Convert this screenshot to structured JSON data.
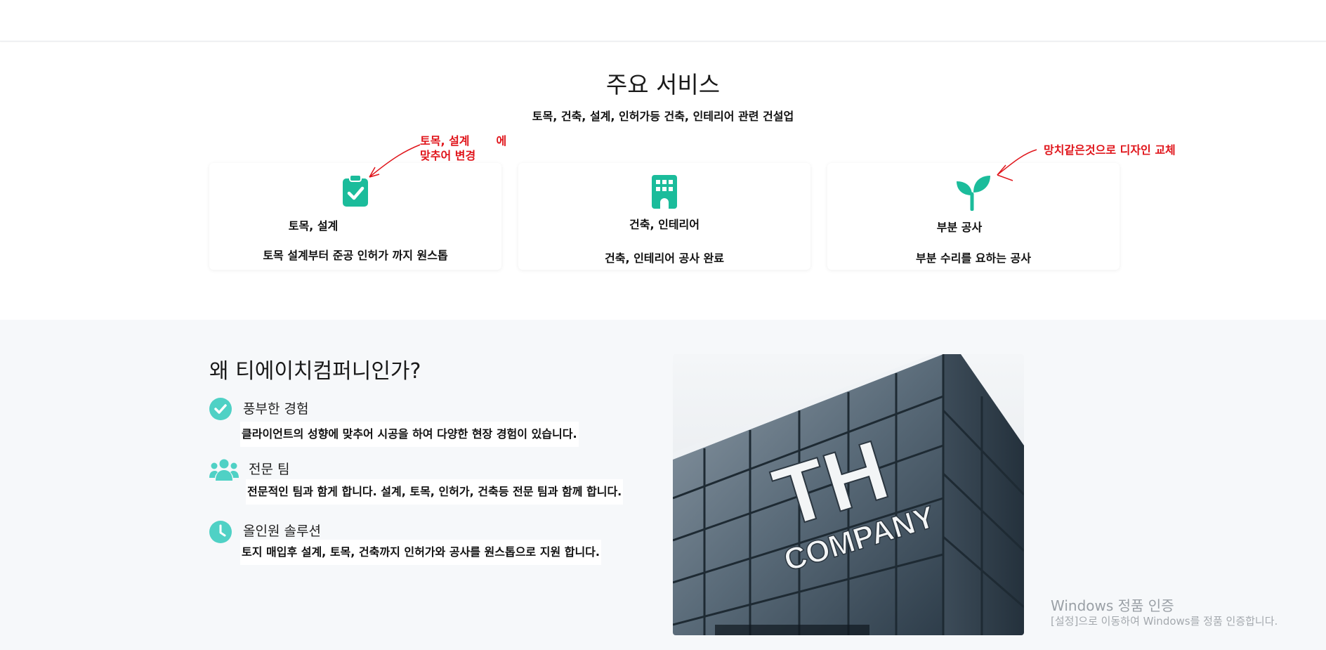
{
  "services": {
    "title": "주요 서비스",
    "subtitle": "토목, 건축, 설계, 인허가등 건축, 인테리어 관련 건설업",
    "cards": [
      {
        "icon": "clipboard-check-icon",
        "title": "토목, 설계",
        "desc": "토목 설계부터 준공 인허가 까지 원스톱"
      },
      {
        "icon": "building-icon",
        "title": "건축, 인테리어",
        "desc": "건축, 인테리어 공사 완료"
      },
      {
        "icon": "sprout-icon",
        "title": "부분 공사",
        "desc": "부분 수리를 요하는 공사"
      }
    ]
  },
  "annotations": {
    "left_line1": "토목, 설계",
    "left_line1_suffix": "에",
    "left_line2": "맞추어 변경",
    "right": "망치같은것으로 디자인 교체"
  },
  "why": {
    "title": "왜 티에이치컴퍼니인가?",
    "features": [
      {
        "icon": "check-circle-icon",
        "title": "풍부한 경험",
        "desc": "클라이언트의 성향에 맞추어 시공을 하여 다양한 현장 경험이 있습니다."
      },
      {
        "icon": "team-icon",
        "title": "전문 팀",
        "desc": "전문적인 팀과 함게 합니다. 설계, 토목, 인허가, 건축등 전문 팀과 함께 합니다."
      },
      {
        "icon": "clock-icon",
        "title": "올인원 솔루션",
        "desc": "토지 매입후 설계, 토목, 건축까지 인허가와 공사를 원스톱으로 지원 합니다."
      }
    ]
  },
  "building_image": {
    "sign_line1": "TH",
    "sign_line2": "COMPANY"
  },
  "windows_watermark": {
    "title": "Windows 정품 인증",
    "subtitle": "[설정]으로 이동하여 Windows를 정품 인증합니다."
  },
  "colors": {
    "accent": "#1bbc9b",
    "icon_light": "#4fd1c5",
    "annotation": "#e0151b",
    "section_bg": "#f6f8fa"
  }
}
